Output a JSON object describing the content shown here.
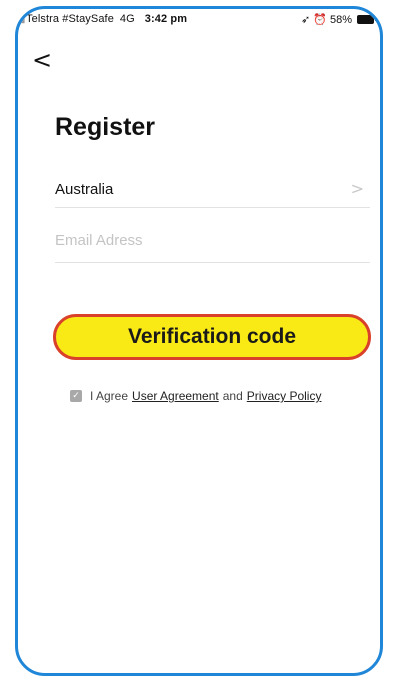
{
  "status_bar": {
    "carrier": "Telstra #StaySafe",
    "network": "4G",
    "time": "3:42 pm",
    "battery": "58%",
    "location_glyph": "➶"
  },
  "header": {
    "back_glyph": "<",
    "title": "Register"
  },
  "form": {
    "country": "Australia",
    "country_chevron": ">",
    "email_placeholder": "Email Adress",
    "verify_label": "Verification code"
  },
  "agreement": {
    "checked": true,
    "check_glyph": "✓",
    "prefix": "I Agree",
    "user_agreement": "User Agreement",
    "and": "and",
    "privacy_policy": "Privacy Policy"
  },
  "colors": {
    "frame_border": "#1f86d8",
    "button_fill": "#f9ea16",
    "button_border": "#d9412a"
  }
}
